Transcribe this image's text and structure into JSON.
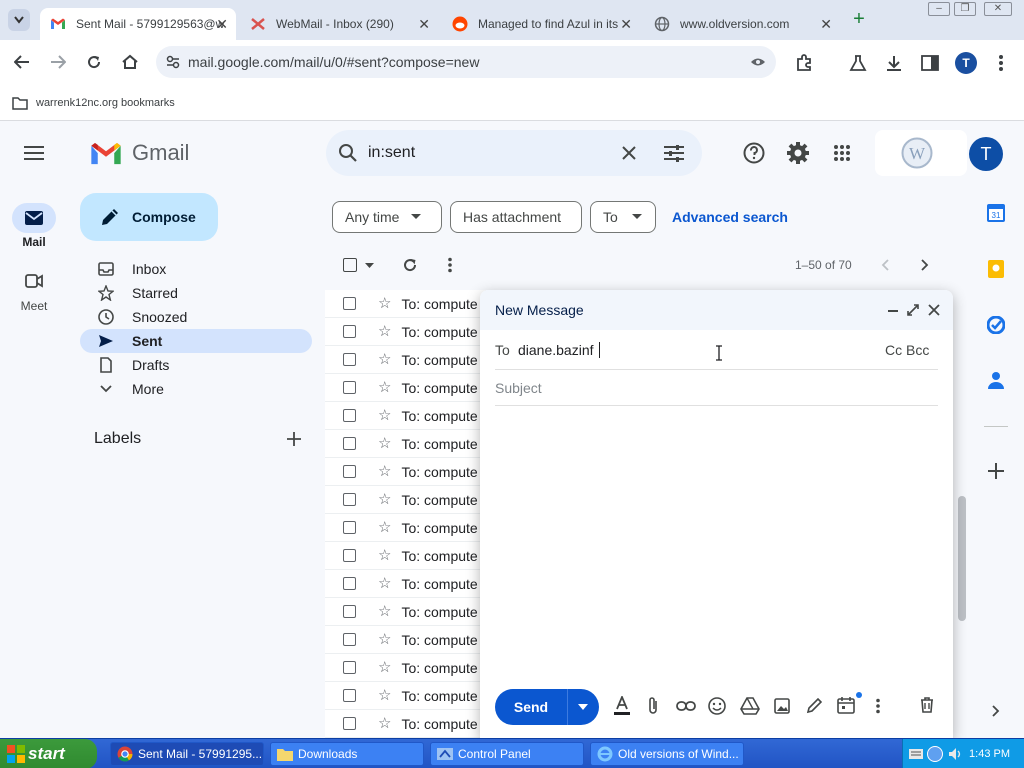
{
  "browser": {
    "tabs": [
      {
        "title": "Sent Mail - 5799129563@w",
        "active": true,
        "icon": "gmail-icon"
      },
      {
        "title": "WebMail - Inbox (290)",
        "active": false,
        "icon": "webmail-icon"
      },
      {
        "title": "Managed to find Azul in its",
        "active": false,
        "icon": "reddit-icon"
      },
      {
        "title": "www.oldversion.com",
        "active": false,
        "icon": "globe-icon"
      }
    ],
    "new_tab": "+",
    "url": "mail.google.com/mail/u/0/#sent?compose=new",
    "profile_initial": "T",
    "bookmarks_folder": "warrenk12nc.org bookmarks"
  },
  "gmail": {
    "logo_text": "Gmail",
    "search_value": "in:sent",
    "account_initial": "T",
    "rail": {
      "mail": "Mail",
      "meet": "Meet"
    },
    "compose_label": "Compose",
    "nav": [
      {
        "label": "Inbox",
        "icon": "inbox-icon"
      },
      {
        "label": "Starred",
        "icon": "star-icon"
      },
      {
        "label": "Snoozed",
        "icon": "clock-icon"
      },
      {
        "label": "Sent",
        "icon": "send-icon",
        "selected": true
      },
      {
        "label": "Drafts",
        "icon": "draft-icon"
      },
      {
        "label": "More",
        "icon": "chevron-down-icon"
      }
    ],
    "labels_heading": "Labels",
    "chips": {
      "any_time": "Any time",
      "has_attachment": "Has attachment",
      "to": "To",
      "advanced": "Advanced search"
    },
    "pagination": "1–50 of 70",
    "row_text": "To: compute",
    "row_count": 16
  },
  "compose": {
    "title": "New Message",
    "to_label": "To",
    "to_value": "diane.bazinf",
    "cc_bcc": "Cc Bcc",
    "subject_placeholder": "Subject",
    "send_label": "Send"
  },
  "taskbar": {
    "start": "start",
    "items": [
      {
        "label": "Sent Mail - 57991295...",
        "active": true
      },
      {
        "label": "Downloads",
        "active": false
      },
      {
        "label": "Control Panel",
        "active": false
      },
      {
        "label": "Old versions of Wind...",
        "active": false
      }
    ],
    "clock": "1:43 PM"
  },
  "colors": {
    "accent": "#0b57d0",
    "compose_btn": "#c2e7ff",
    "sent_highlight": "#d3e3fd",
    "taskbar": "#245edb",
    "start": "#3a9a3a"
  }
}
